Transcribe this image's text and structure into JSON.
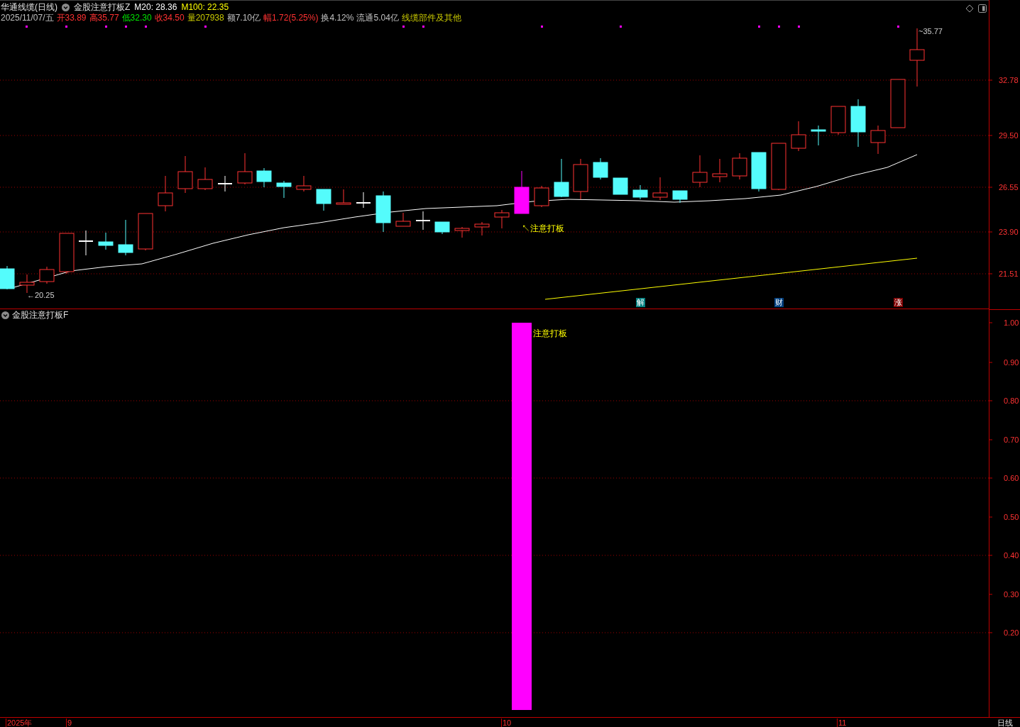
{
  "header": {
    "stock": "华通线缆(日线)",
    "indicator": "金股注意打板Z",
    "ma": [
      {
        "label": "M20: 28.36",
        "color": "#ffffff"
      },
      {
        "label": "M100: 22.35",
        "color": "#ffff00"
      }
    ]
  },
  "quote": [
    {
      "text": "2025/11/07/五",
      "kind": "neutral"
    },
    {
      "text": "开33.89",
      "kind": "up"
    },
    {
      "text": "高35.77",
      "kind": "up"
    },
    {
      "text": "低32.30",
      "kind": "down"
    },
    {
      "text": "收34.50",
      "kind": "up"
    },
    {
      "text": "量207938",
      "kind": "volume"
    },
    {
      "text": "额7.10亿",
      "kind": "neutral"
    },
    {
      "text": "幅1.72(5.25%)",
      "kind": "up"
    },
    {
      "text": "换4.12%",
      "kind": "neutral"
    },
    {
      "text": "流通5.04亿",
      "kind": "neutral"
    },
    {
      "text": "线缆部件及其他",
      "kind": "sector"
    }
  ],
  "price_axis": [
    "32.78",
    "29.50",
    "26.55",
    "23.90",
    "21.51"
  ],
  "annotations": {
    "low": "←20.25",
    "high": "~35.77",
    "signal": "↖注意打板"
  },
  "event_tags": [
    {
      "text": "解",
      "color": "#007f7f"
    },
    {
      "text": "财",
      "color": "#00407f"
    },
    {
      "text": "涨",
      "color": "#800000"
    }
  ],
  "lower_panel": {
    "title": "金股注意打板F",
    "signal": "注意打板",
    "axis": [
      "1.00",
      "0.90",
      "0.80",
      "0.70",
      "0.60",
      "0.50",
      "0.40",
      "0.30",
      "0.20"
    ]
  },
  "time_axis": [
    "2025年",
    "9",
    "10",
    "11"
  ],
  "period": "日线"
}
